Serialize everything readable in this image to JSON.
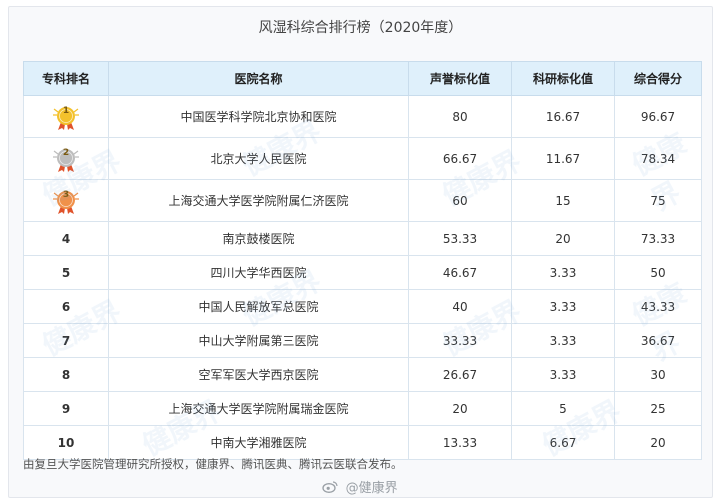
{
  "title": "风湿科综合排行榜（2020年度）",
  "headers": {
    "rank": "专科排名",
    "hospital": "医院名称",
    "reputation": "声誉标化值",
    "research": "科研标化值",
    "total": "综合得分"
  },
  "rows": [
    {
      "rank": "1",
      "medal": "gold",
      "hospital": "中国医学科学院北京协和医院",
      "reputation": "80",
      "research": "16.67",
      "total": "96.67"
    },
    {
      "rank": "2",
      "medal": "silver",
      "hospital": "北京大学人民医院",
      "reputation": "66.67",
      "research": "11.67",
      "total": "78.34"
    },
    {
      "rank": "3",
      "medal": "bronze",
      "hospital": "上海交通大学医学院附属仁济医院",
      "reputation": "60",
      "research": "15",
      "total": "75"
    },
    {
      "rank": "4",
      "hospital": "南京鼓楼医院",
      "reputation": "53.33",
      "research": "20",
      "total": "73.33"
    },
    {
      "rank": "5",
      "hospital": "四川大学华西医院",
      "reputation": "46.67",
      "research": "3.33",
      "total": "50"
    },
    {
      "rank": "6",
      "hospital": "中国人民解放军总医院",
      "reputation": "40",
      "research": "3.33",
      "total": "43.33"
    },
    {
      "rank": "7",
      "hospital": "中山大学附属第三医院",
      "reputation": "33.33",
      "research": "3.33",
      "total": "36.67"
    },
    {
      "rank": "8",
      "hospital": "空军军医大学西京医院",
      "reputation": "26.67",
      "research": "3.33",
      "total": "30"
    },
    {
      "rank": "9",
      "hospital": "上海交通大学医学院附属瑞金医院",
      "reputation": "20",
      "research": "5",
      "total": "25"
    },
    {
      "rank": "10",
      "hospital": "中南大学湘雅医院",
      "reputation": "13.33",
      "research": "6.67",
      "total": "20"
    }
  ],
  "footer": "由复旦大学医院管理研究所授权，健康界、腾讯医典、腾讯云医联合发布。",
  "watermark": "@健康界",
  "background_watermark": "健康界",
  "colors": {
    "header_bg": "#dff0fb",
    "gold": "#f3c12c",
    "silver": "#bdbdbd",
    "bronze": "#f0914a",
    "ribbon": "#e0532b"
  }
}
